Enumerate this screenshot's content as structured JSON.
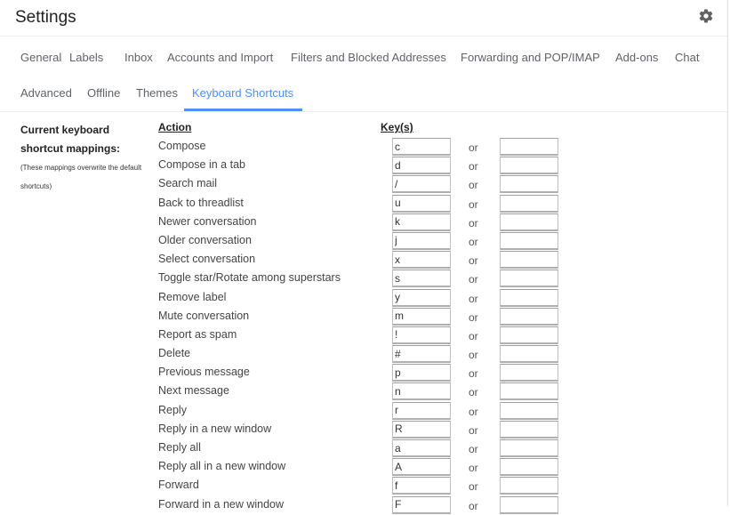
{
  "header": {
    "title": "Settings",
    "settings_icon": "gear-icon"
  },
  "tabs": [
    {
      "label": "General",
      "active": false
    },
    {
      "label": "Labels",
      "active": false
    },
    {
      "label": "Inbox",
      "active": false
    },
    {
      "label": "Accounts and Import",
      "active": false
    },
    {
      "label": "Filters and Blocked Addresses",
      "active": false
    },
    {
      "label": "Forwarding and POP/IMAP",
      "active": false
    },
    {
      "label": "Add-ons",
      "active": false
    },
    {
      "label": "Chat",
      "active": false
    },
    {
      "label": "Advanced",
      "active": false
    },
    {
      "label": "Offline",
      "active": false
    },
    {
      "label": "Themes",
      "active": false
    },
    {
      "label": "Keyboard Shortcuts",
      "active": true
    }
  ],
  "accent_color": "#4d90fe",
  "section": {
    "title": "Current keyboard shortcut mappings:",
    "note": "(These mappings overwrite the default shortcuts)",
    "action_header": "Action",
    "keys_header": "Key(s)",
    "or_label": "or"
  },
  "shortcuts": [
    {
      "action": "Compose",
      "key": "c",
      "alt_key": ""
    },
    {
      "action": "Compose in a tab",
      "key": "d",
      "alt_key": ""
    },
    {
      "action": "Search mail",
      "key": "/",
      "alt_key": ""
    },
    {
      "action": "Back to threadlist",
      "key": "u",
      "alt_key": ""
    },
    {
      "action": "Newer conversation",
      "key": "k",
      "alt_key": ""
    },
    {
      "action": "Older conversation",
      "key": "j",
      "alt_key": ""
    },
    {
      "action": "Select conversation",
      "key": "x",
      "alt_key": ""
    },
    {
      "action": "Toggle star/Rotate among superstars",
      "key": "s",
      "alt_key": ""
    },
    {
      "action": "Remove label",
      "key": "y",
      "alt_key": ""
    },
    {
      "action": "Mute conversation",
      "key": "m",
      "alt_key": ""
    },
    {
      "action": "Report as spam",
      "key": "!",
      "alt_key": ""
    },
    {
      "action": "Delete",
      "key": "#",
      "alt_key": ""
    },
    {
      "action": "Previous message",
      "key": "p",
      "alt_key": ""
    },
    {
      "action": "Next message",
      "key": "n",
      "alt_key": ""
    },
    {
      "action": "Reply",
      "key": "r",
      "alt_key": ""
    },
    {
      "action": "Reply in a new window",
      "key": "R",
      "alt_key": ""
    },
    {
      "action": "Reply all",
      "key": "a",
      "alt_key": ""
    },
    {
      "action": "Reply all in a new window",
      "key": "A",
      "alt_key": ""
    },
    {
      "action": "Forward",
      "key": "f",
      "alt_key": ""
    },
    {
      "action": "Forward in a new window",
      "key": "F",
      "alt_key": ""
    }
  ]
}
